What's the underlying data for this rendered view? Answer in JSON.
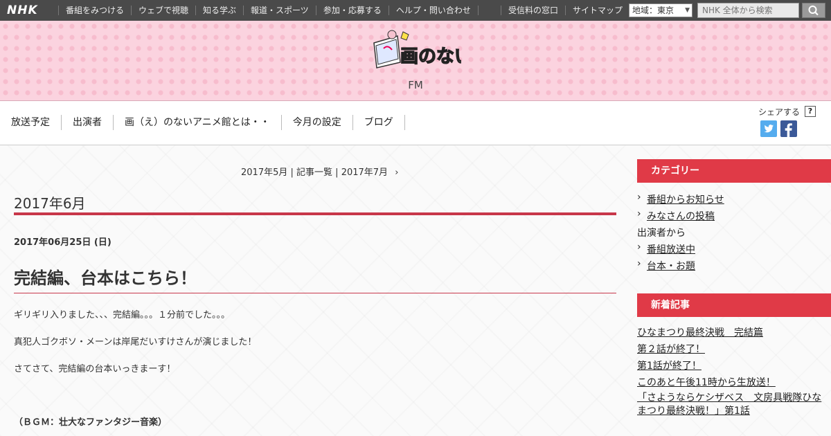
{
  "global_bar": {
    "logo": "NHK",
    "nav": [
      "番組をみつける",
      "ウェブで視聴",
      "知る学ぶ",
      "報道・スポーツ",
      "参加・応募する",
      "ヘルプ・問い合わせ"
    ],
    "right_nav": [
      "受信料の窓口",
      "サイトマップ"
    ],
    "region": "地域：東京",
    "search_placeholder": "NHK 全体から検索"
  },
  "header": {
    "logo_text": "画のないアニメ館",
    "station": "FM"
  },
  "program_nav": {
    "items": [
      "放送予定",
      "出演者",
      "画（え）のないアニメ館とは・・",
      "今月の設定",
      "ブログ"
    ],
    "share_label": "シェアする",
    "help": "?"
  },
  "main": {
    "pager": {
      "prev": "2017年5月",
      "sep1": " | ",
      "index": "記事一覧",
      "sep2": " | ",
      "next": "2017年7月",
      "arrow": "›"
    },
    "month_title": "2017年6月",
    "post": {
      "date": "2017年06月25日 (日)",
      "title": "完結編、台本はこちら！",
      "paragraphs": [
        "ギリギリ入りました、、、完結編。。。１分前でした。。。",
        "真犯人ゴクボソ・メーンは岸尾だいすけさんが演じました！",
        "さてさて、完結編の台本いっきまーす！"
      ],
      "bgm": "（ＢＧＭ：壮大なファンタジー音楽）"
    }
  },
  "sidebar": {
    "category_heading": "カテゴリー",
    "categories": [
      {
        "label": "番組からお知らせ",
        "link": true
      },
      {
        "label": "みなさんの投稿",
        "link": true
      },
      {
        "label": "出演者から",
        "link": false
      },
      {
        "label": "番組放送中",
        "link": true
      },
      {
        "label": "台本・お題",
        "link": true
      }
    ],
    "recent_heading": "新着記事",
    "recent": [
      "ひなまつり最終決戦　完結篇",
      "第２話が終了！",
      "第1話が終了！",
      "このあと午後11時から生放送！",
      "「さようならケシザベス　文房具戦隊ひなまつり最終決戦！」第1話"
    ]
  },
  "colors": {
    "accent": "#e03a47",
    "rule": "#c8374a",
    "header_pink": "#fbd3df",
    "twitter": "#55acee",
    "facebook": "#3b5998"
  }
}
